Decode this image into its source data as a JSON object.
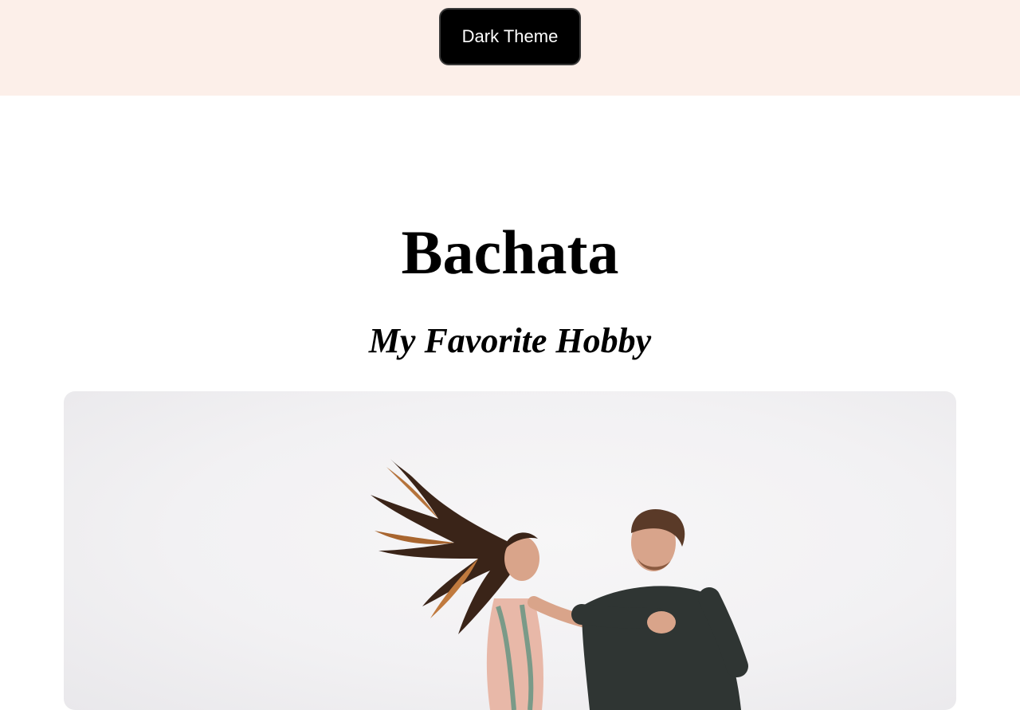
{
  "header": {
    "theme_button_label": "Dark Theme",
    "background_color": "#fcefe9"
  },
  "main": {
    "title": "Bachata",
    "subtitle": "My Favorite Hobby"
  },
  "colors": {
    "button_bg": "#000000",
    "button_text": "#ffffff",
    "text": "#000000"
  }
}
